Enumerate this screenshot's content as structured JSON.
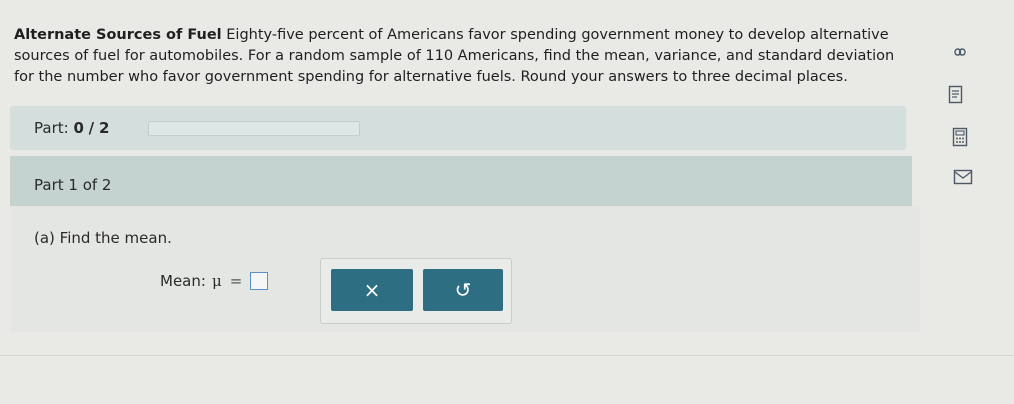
{
  "problem": {
    "title": "Alternate Sources of Fuel",
    "text": "Eighty-five percent of Americans favor spending government money to develop alternative sources of fuel for automobiles. For a random sample of 110 Americans, find the mean, variance, and standard deviation for the number who favor government spending for alternative fuels. Round your answers to three decimal places."
  },
  "progress": {
    "label": "Part:",
    "current": "0",
    "separator": "/",
    "total": "2",
    "fraction": 0
  },
  "part": {
    "header": "Part 1 of 2",
    "question": "(a) Find the mean.",
    "answer_label": "Mean:",
    "symbol": "μ",
    "equals": "=",
    "answer_value": ""
  },
  "tools": {
    "clear_symbol": "×",
    "undo_symbol": "↺"
  },
  "sidebar_icons": [
    "infinity-icon",
    "notes-icon",
    "calculator-icon",
    "mail-icon"
  ],
  "colors": {
    "button": "#2d6e83",
    "part_header": "#c4d2d0",
    "part_bar": "#d4dfdd"
  }
}
